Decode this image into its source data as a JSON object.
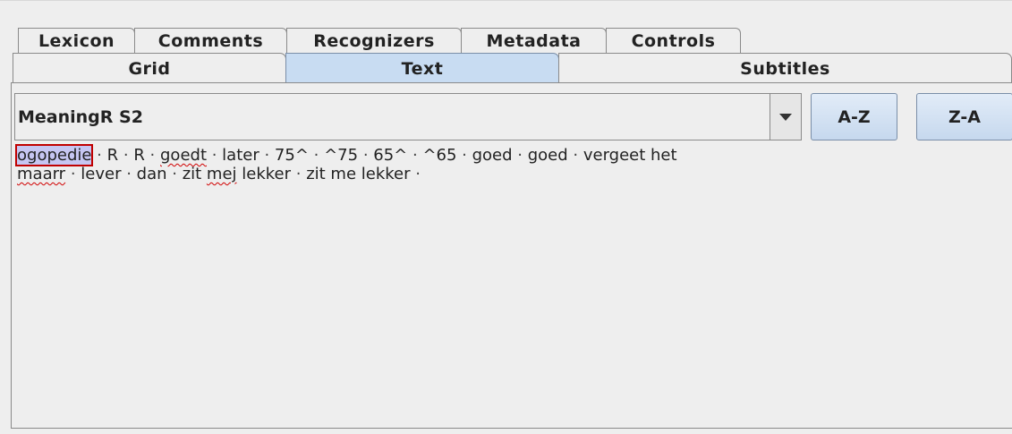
{
  "tabs_row1": [
    "Lexicon",
    "Comments",
    "Recognizers",
    "Metadata",
    "Controls"
  ],
  "tabs_row2": [
    {
      "label": "Grid",
      "active": false
    },
    {
      "label": "Text",
      "active": true
    },
    {
      "label": "Subtitles",
      "active": false
    }
  ],
  "tier_selector": {
    "value": "MeaningR S2",
    "icon": "chevron-down-icon"
  },
  "sort_buttons": {
    "az": "A-Z",
    "za": "Z-A"
  },
  "separator": "·",
  "annotations": {
    "line1": [
      {
        "text": "ogopedie",
        "selected": true,
        "misspelled": false
      },
      {
        "text": "R"
      },
      {
        "text": "R"
      },
      {
        "text": "goedt",
        "misspelled": true
      },
      {
        "text": "later"
      },
      {
        "text": "75^"
      },
      {
        "text": "^75"
      },
      {
        "text": "65^"
      },
      {
        "text": "^65"
      },
      {
        "text": "goed"
      },
      {
        "text": "goed"
      },
      {
        "text": "vergeet het"
      }
    ],
    "line2": [
      {
        "text": "maarr",
        "misspelled": true
      },
      {
        "text": "lever"
      },
      {
        "text": "dan"
      },
      {
        "text": "zit mej lekker",
        "parts": [
          {
            "text": "zit "
          },
          {
            "text": "mej",
            "misspelled": true
          },
          {
            "text": " lekker"
          }
        ]
      },
      {
        "text": "zit me lekker"
      },
      {
        "text": ""
      }
    ]
  },
  "colors": {
    "active_tab": "#c8dcf2",
    "selection_fill": "#c6c6f2",
    "selection_border": "#c00000",
    "spell_underline": "#d00000"
  }
}
